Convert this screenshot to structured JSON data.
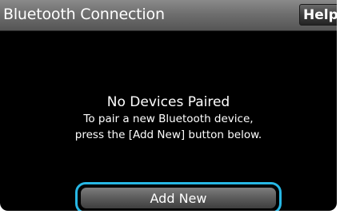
{
  "header": {
    "title": "Bluetooth Connection",
    "help_label": "Help"
  },
  "message": {
    "heading": "No Devices Paired",
    "line1": "To pair a new Bluetooth device,",
    "line2": "press the [Add New] button below."
  },
  "actions": {
    "add_new_label": "Add New"
  },
  "colors": {
    "screen_background": "#000000",
    "titlebar": "#6f6f6f",
    "focus_ring": "#27b7e4",
    "text": "#ffffff"
  }
}
